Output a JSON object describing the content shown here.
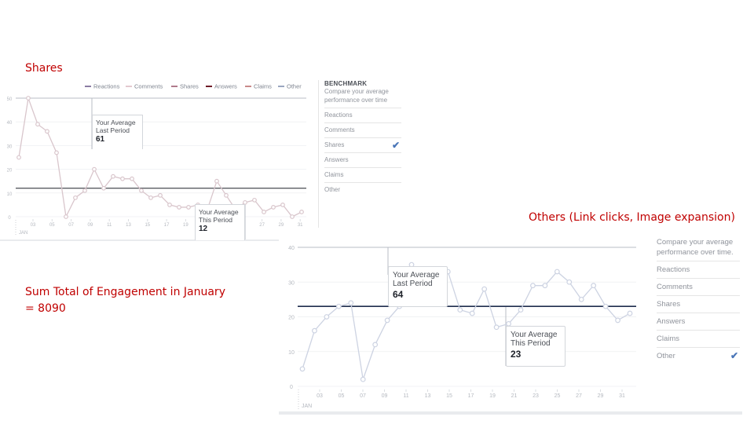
{
  "headings": {
    "shares": "Shares",
    "others": "Others (Link clicks, Image expansion)",
    "total_line1": "Sum Total of Engagement in January",
    "total_line2": "= 8090"
  },
  "colors": {
    "heading": "#c00000",
    "shares_line": "#d9c6cc",
    "other_line": "#cdd3e2",
    "average_line_1": "#1d2129",
    "average_line_2": "#1f2d4d",
    "checkmark": "#4a76b8",
    "legend": {
      "Reactions": "#8b7ca3",
      "Comments": "#e3c9cf",
      "Shares": "#b07a8c",
      "Answers": "#6e1b27",
      "Claims": "#c98a8a",
      "Other": "#9aa6c0"
    }
  },
  "legend": [
    "Reactions",
    "Comments",
    "Shares",
    "Answers",
    "Claims",
    "Other"
  ],
  "benchmark1": {
    "title": "BENCHMARK",
    "description_line1": "Compare your average",
    "description_line2": "performance over time",
    "items": [
      {
        "label": "Reactions",
        "selected": false
      },
      {
        "label": "Comments",
        "selected": false
      },
      {
        "label": "Shares",
        "selected": true
      },
      {
        "label": "Answers",
        "selected": false
      },
      {
        "label": "Claims",
        "selected": false
      },
      {
        "label": "Other",
        "selected": false
      }
    ],
    "check": "✔"
  },
  "benchmark2": {
    "description_line1": "Compare your average",
    "description_line2": "performance over time.",
    "items": [
      {
        "label": "Reactions",
        "selected": false
      },
      {
        "label": "Comments",
        "selected": false
      },
      {
        "label": "Shares",
        "selected": false
      },
      {
        "label": "Answers",
        "selected": false
      },
      {
        "label": "Claims",
        "selected": false
      },
      {
        "label": "Other",
        "selected": true
      }
    ],
    "check": "✔"
  },
  "tooltips": {
    "c1_last": {
      "line1": "Your Average",
      "line2": "Last Period",
      "value": "61"
    },
    "c1_this": {
      "line1": "Your Average",
      "line2": "This Period",
      "value": "12"
    },
    "c2_last": {
      "line1": "Your Average",
      "line2": "Last Period",
      "value": "64"
    },
    "c2_this": {
      "line1": "Your Average",
      "line2": "This Period",
      "value": "23"
    }
  },
  "chart_data": [
    {
      "type": "line",
      "title": "Shares",
      "xlabel": "JAN",
      "ylabel": "",
      "ylim": [
        0,
        50
      ],
      "yticks": [
        0,
        10,
        20,
        30,
        40,
        50
      ],
      "x_tick_labels": [
        "03",
        "05",
        "07",
        "09",
        "11",
        "13",
        "15",
        "17",
        "19",
        "21",
        "23",
        "25",
        "27",
        "29",
        "31"
      ],
      "grid": true,
      "legend_position": "top-right",
      "series": [
        {
          "name": "Shares",
          "values": [
            25,
            50,
            39,
            36,
            27,
            0,
            8,
            11,
            20,
            12,
            17,
            16,
            16,
            11,
            8,
            9,
            5,
            4,
            4,
            5,
            3,
            15,
            9,
            3,
            6,
            7,
            2,
            4,
            5,
            0,
            2
          ]
        }
      ],
      "average_this_period": 12,
      "average_last_period": 61
    },
    {
      "type": "line",
      "title": "Others (Link clicks, Image expansion)",
      "xlabel": "JAN",
      "ylabel": "",
      "ylim": [
        0,
        40
      ],
      "yticks": [
        0,
        10,
        20,
        30,
        40
      ],
      "x_tick_labels": [
        "03",
        "05",
        "07",
        "09",
        "11",
        "13",
        "15",
        "17",
        "19",
        "21",
        "23",
        "25",
        "27",
        "29",
        "31"
      ],
      "grid": true,
      "series": [
        {
          "name": "Other",
          "values": [
            5,
            16,
            20,
            23,
            24,
            2,
            12,
            19,
            23,
            35,
            25,
            25,
            33,
            22,
            21,
            28,
            17,
            18,
            22,
            29,
            29,
            33,
            30,
            25,
            29,
            23,
            19,
            21
          ]
        }
      ],
      "average_this_period": 23,
      "average_last_period": 64
    }
  ]
}
